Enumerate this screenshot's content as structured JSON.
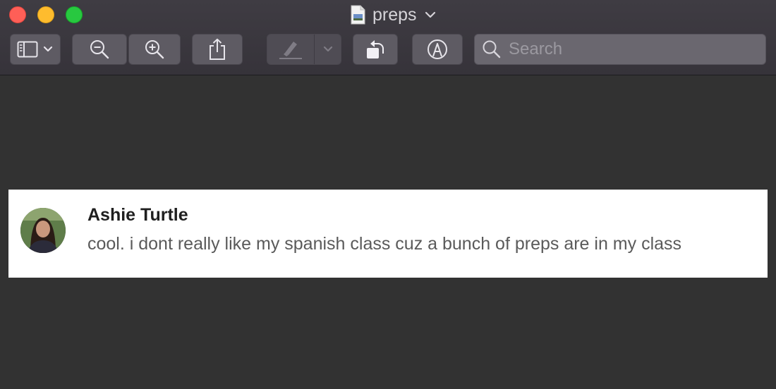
{
  "window": {
    "title": "preps"
  },
  "toolbar": {
    "search_placeholder": "Search",
    "buttons": [
      {
        "name": "sidebar-toggle",
        "icon": "sidebar-icon"
      },
      {
        "name": "zoom-out",
        "icon": "zoom-out-icon"
      },
      {
        "name": "zoom-in",
        "icon": "zoom-in-icon"
      },
      {
        "name": "share",
        "icon": "share-icon"
      },
      {
        "name": "highlight",
        "icon": "pen-icon",
        "enabled": false
      },
      {
        "name": "rotate",
        "icon": "rotate-left-icon"
      },
      {
        "name": "markup",
        "icon": "markup-icon"
      }
    ]
  },
  "message": {
    "sender": "Ashie Turtle",
    "text": "cool. i dont really like my spanish class cuz a bunch of preps are in my class"
  },
  "colors": {
    "close": "#fe5f57",
    "minimize": "#febc2e",
    "maximize": "#28c840",
    "background": "#323232"
  }
}
